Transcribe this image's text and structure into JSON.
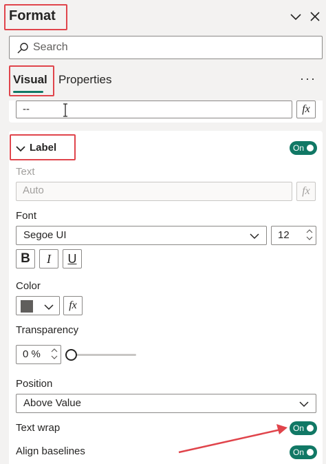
{
  "header": {
    "title": "Format"
  },
  "search": {
    "placeholder": "Search"
  },
  "tabs": {
    "visual": "Visual",
    "properties": "Properties",
    "more": "···"
  },
  "top_field": {
    "value": "--",
    "fx": "fx"
  },
  "label_section": {
    "title": "Label",
    "toggle": "On",
    "text_label": "Text",
    "text_value": "Auto",
    "text_fx": "fx",
    "font_label": "Font",
    "font_family": "Segoe UI",
    "font_size": "12",
    "bold": "B",
    "italic": "I",
    "underline": "U",
    "color_label": "Color",
    "color_fx": "fx",
    "color_value": "#605e5c",
    "transparency_label": "Transparency",
    "transparency_value": "0 %",
    "transparency_level": 0,
    "position_label": "Position",
    "position_value": "Above Value",
    "text_wrap_label": "Text wrap",
    "text_wrap_toggle": "On",
    "align_baselines_label": "Align baselines",
    "align_baselines_toggle": "On"
  },
  "colors": {
    "accent": "#117865",
    "highlight": "#e0444b"
  }
}
